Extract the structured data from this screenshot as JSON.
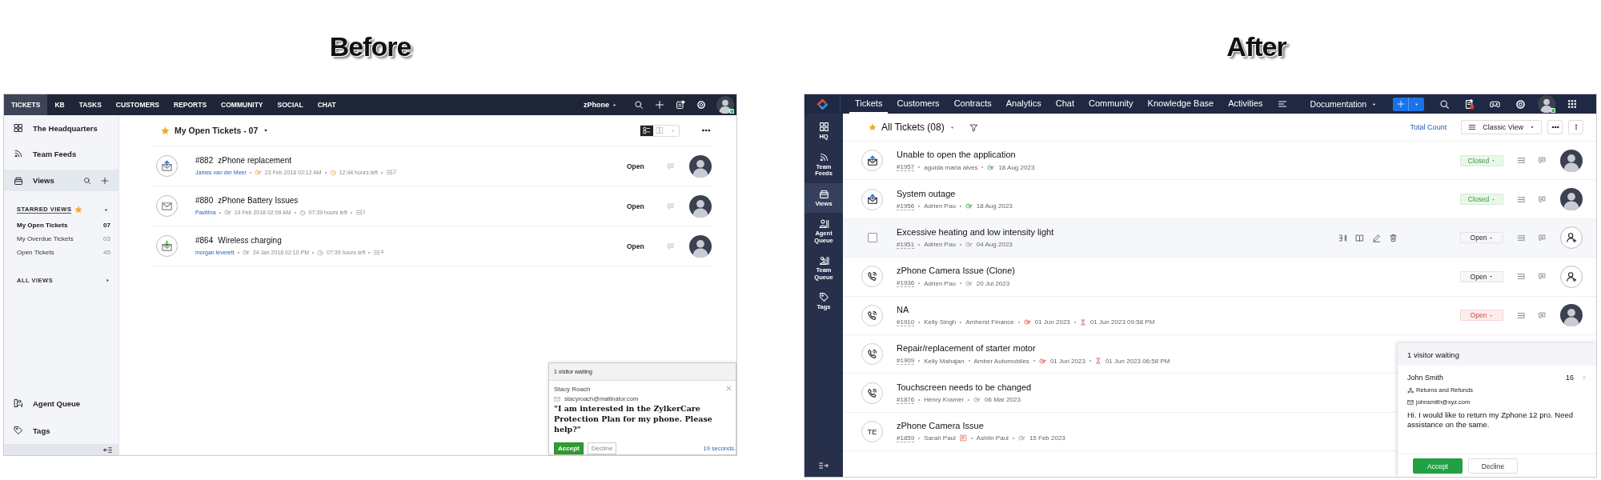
{
  "panels": [
    {
      "kind": "classic",
      "caption": "Before",
      "nav": {
        "tabs": [
          {
            "label": "TICKETS",
            "selected": true
          },
          {
            "label": "KB",
            "selected": false
          },
          {
            "label": "TASKS",
            "selected": false
          },
          {
            "label": "CUSTOMERS",
            "selected": false
          },
          {
            "label": "REPORTS",
            "selected": false
          },
          {
            "label": "COMMUNITY",
            "selected": false
          },
          {
            "label": "SOCIAL",
            "selected": false
          },
          {
            "label": "CHAT",
            "selected": false
          }
        ],
        "portal": "zPhone"
      },
      "sidebar": {
        "items": [
          {
            "label": "The Headquarters",
            "selected": false
          },
          {
            "label": "Team Feeds",
            "selected": false
          },
          {
            "label": "Views",
            "selected": true
          }
        ],
        "starred_heading": "STARRED VIEWS",
        "views": [
          {
            "label": "My Open Tickets",
            "count": "07",
            "selected": true
          },
          {
            "label": "My Overdue Tickets",
            "count": "03",
            "selected": false
          },
          {
            "label": "Open Tickets",
            "count": "45",
            "selected": false
          }
        ],
        "all_views": "ALL VIEWS",
        "bottom_items": [
          {
            "label": "Agent Queue"
          },
          {
            "label": "Tags"
          }
        ]
      },
      "header": {
        "title": "My Open Tickets - 07",
        "starred": true,
        "list_view": true
      },
      "tickets": [
        {
          "kind": "outgoing",
          "number": "#882",
          "subject": "zPhone replacement",
          "contact": "James van der Meer",
          "created": "23 Feb 2018 02:12 AM",
          "due": "12:44 hours left",
          "due_soon": true,
          "threads": "2",
          "status": "Open"
        },
        {
          "kind": "email",
          "number": "#880",
          "subject": "zPhone Battery Issues",
          "contact": "Pavithra",
          "created": "14 Feb 2018 02:09 AM",
          "due": "07:39 hours left",
          "due_soon": false,
          "threads": "1",
          "status": "Open"
        },
        {
          "kind": "incoming",
          "number": "#864",
          "subject": "Wireless charging",
          "contact": "morgan leverett",
          "created": "24 Jan 2018 02:10 PM",
          "due": "07:39 hours left",
          "due_soon": false,
          "threads": "4",
          "status": "Open"
        }
      ],
      "chat": {
        "title": "1 visitor waiting",
        "name": "Stacy Roach",
        "email": "stacyroach@mailinator.com",
        "message": "\"I am interested in the ZylkerCare Protection Plan for my phone. Please help?\"",
        "accept": "Accept",
        "decline": "Decline",
        "timer": "19 seconds."
      }
    },
    {
      "kind": "modern",
      "caption": "After",
      "nav": {
        "tabs": [
          {
            "label": "Tickets",
            "selected": true
          },
          {
            "label": "Customers",
            "selected": false
          },
          {
            "label": "Contracts",
            "selected": false
          },
          {
            "label": "Analytics",
            "selected": false
          },
          {
            "label": "Chat",
            "selected": false
          },
          {
            "label": "Community",
            "selected": false
          },
          {
            "label": "Knowledge Base",
            "selected": false
          },
          {
            "label": "Activities",
            "selected": false
          }
        ],
        "portal": "Documentation"
      },
      "sidebar": {
        "items": [
          {
            "label": "HQ",
            "selected": false
          },
          {
            "label": "Team Feeds",
            "selected": false
          },
          {
            "label": "Views",
            "selected": true
          },
          {
            "label": "Agent Queue",
            "selected": false
          },
          {
            "label": "Team Queue",
            "selected": false
          },
          {
            "label": "Tags",
            "selected": false
          }
        ]
      },
      "header": {
        "title": "All Tickets (08)",
        "starred": true,
        "total_link": "Total Count",
        "view": "Classic View"
      },
      "tickets": [
        {
          "kind": "email",
          "hovered": false,
          "subject": "Unable to open the application",
          "number": "#1957",
          "contact": "aguida maria alves",
          "contact_flag": false,
          "created": "18 Aug 2023",
          "closed": true,
          "overdue": false,
          "status": "Closed",
          "assigned": true
        },
        {
          "kind": "email",
          "hovered": false,
          "subject": "System outage",
          "number": "#1956",
          "contact": "Adrien Pau",
          "contact_flag": false,
          "created": "18 Aug 2023",
          "closed": true,
          "overdue": false,
          "status": "Closed",
          "assigned": true
        },
        {
          "hovered": true,
          "subject": "Excessive heating and low intensity light",
          "number": "#1951",
          "contact": "Adrien Pau",
          "contact_flag": false,
          "created": "04 Aug 2023",
          "closed": false,
          "overdue": false,
          "status": "Open",
          "assigned": false
        },
        {
          "kind": "phone",
          "hovered": false,
          "subject": "zPhone Camera Issue (Clone)",
          "number": "#1936",
          "contact": "Adrien Pau",
          "contact_flag": false,
          "created": "20 Jul 2023",
          "closed": false,
          "overdue": false,
          "status": "Open",
          "assigned": false
        },
        {
          "kind": "phone",
          "hovered": false,
          "subject": "NA",
          "number": "#1910",
          "contact": "Kelly Singh",
          "contact_flag": false,
          "account": "Amherst Finance",
          "created": "01 Jun 2023",
          "due": "01 Jun 2023 09:58 PM",
          "closed": false,
          "overdue": true,
          "status": "Open",
          "assigned": true
        },
        {
          "kind": "phone",
          "hovered": false,
          "subject": "Repair/replacement of starter motor",
          "number": "#1909",
          "contact": "Kelly Mahajan",
          "contact_flag": false,
          "account": "Amber Automobiles",
          "created": "01 Jun 2023",
          "due": "01 Jun 2023 06:58 PM",
          "closed": false,
          "overdue": true
        },
        {
          "kind": "phone",
          "hovered": false,
          "subject": "Touchscreen needs to be changed",
          "number": "#1876",
          "contact": "Henry Kramer",
          "contact_flag": false,
          "created": "06 Mar 2023",
          "closed": false,
          "overdue": false
        },
        {
          "kind": "initials",
          "initials": "TE",
          "hovered": false,
          "subject": "zPhone Camera Issue",
          "number": "#1859",
          "contact": "Sarah Paul",
          "contact_flag": true,
          "account": "Ashlin Paul",
          "created": "15 Feb 2023",
          "closed": false,
          "overdue": false
        }
      ],
      "chat": {
        "title": "1 visitor waiting",
        "name": "John Smith",
        "count": "16",
        "department": "Returns and Refunds",
        "email": "johnsmith@xyz.com",
        "message": "Hi. I would like to return my Zphone 12 pro. Need assistance on the same.",
        "accept": "Accept",
        "decline": "Decline"
      }
    }
  ]
}
